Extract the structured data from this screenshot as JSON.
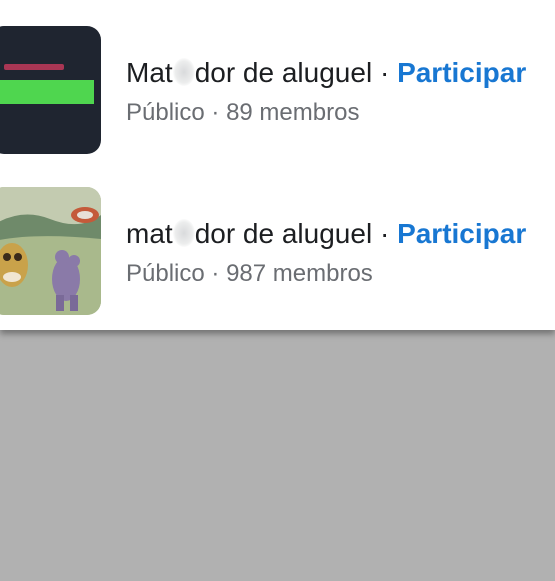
{
  "groups": [
    {
      "name_prefix": "Mat",
      "name_suffix": "dor de aluguel",
      "separator": "·",
      "action_label": "Participar",
      "privacy": "Público",
      "meta_separator": "·",
      "members": "89 membros",
      "thumbnail": "dark-banner-image"
    },
    {
      "name_prefix": "mat",
      "name_suffix": "dor de aluguel",
      "separator": "·",
      "action_label": "Participar",
      "privacy": "Público",
      "meta_separator": "·",
      "members": "987 membros",
      "thumbnail": "cartoon-scene-image"
    }
  ],
  "colors": {
    "action": "#1877d2",
    "title": "#1c1e21",
    "meta": "#6a6d72",
    "background": "#b1b1b1"
  }
}
